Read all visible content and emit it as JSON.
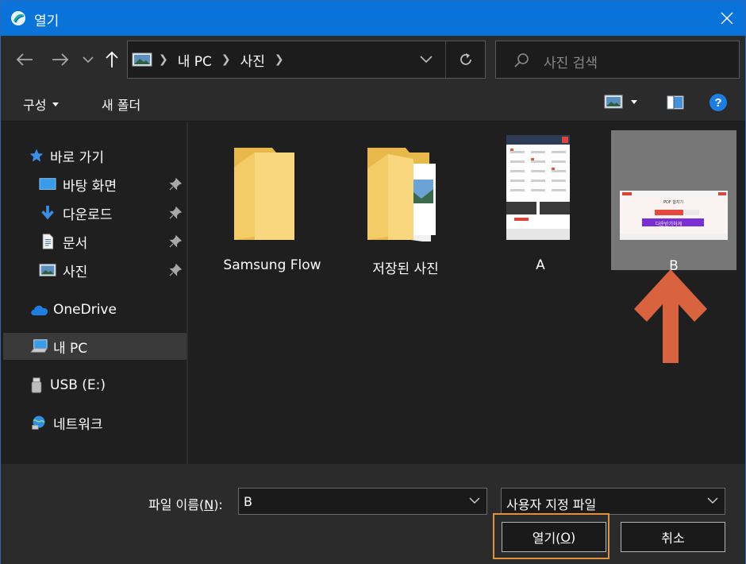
{
  "window": {
    "title": "열기",
    "accent": "#0a73d9"
  },
  "nav": {
    "back_icon": "arrow-left-icon",
    "forward_icon": "arrow-right-icon",
    "recent_icon": "chevron-down-icon",
    "up_icon": "arrow-up-icon"
  },
  "address": {
    "crumbs": [
      "내 PC",
      "사진"
    ],
    "refresh_icon": "refresh-icon"
  },
  "search": {
    "placeholder": "사진 검색"
  },
  "toolbar": {
    "organize": "구성",
    "new_folder": "새 폴더"
  },
  "sidebar": {
    "items": [
      {
        "label": "바로 가기",
        "icon": "star-icon"
      },
      {
        "label": "바탕 화면",
        "icon": "desktop-icon",
        "pinned": true
      },
      {
        "label": "다운로드",
        "icon": "download-icon",
        "pinned": true
      },
      {
        "label": "문서",
        "icon": "document-icon",
        "pinned": true
      },
      {
        "label": "사진",
        "icon": "pictures-icon",
        "pinned": true
      },
      {
        "label": "OneDrive",
        "icon": "cloud-icon"
      },
      {
        "label": "내 PC",
        "icon": "computer-icon",
        "selected": true
      },
      {
        "label": "USB (E:)",
        "icon": "usb-drive-icon"
      },
      {
        "label": "네트워크",
        "icon": "network-icon"
      }
    ]
  },
  "files": [
    {
      "name": "Samsung Flow",
      "kind": "folder"
    },
    {
      "name": "저장된 사진",
      "kind": "folder"
    },
    {
      "name": "A",
      "kind": "image"
    },
    {
      "name": "B",
      "kind": "image",
      "selected": true
    }
  ],
  "thumbnail_b": {
    "heading": "PDF 합치기",
    "button": "다운받기하게"
  },
  "bottom": {
    "filename_label": "파일 이름(",
    "filename_key": "N",
    "filename_label_end": "):",
    "filename_value": "B",
    "filetype_value": "사용자 지정 파일",
    "open_label": "열기(",
    "open_key": "O",
    "open_label_end": ")",
    "cancel_label": "취소"
  },
  "annotation": {
    "arrow_color": "#d9623f",
    "focus_color": "#e0913a"
  }
}
